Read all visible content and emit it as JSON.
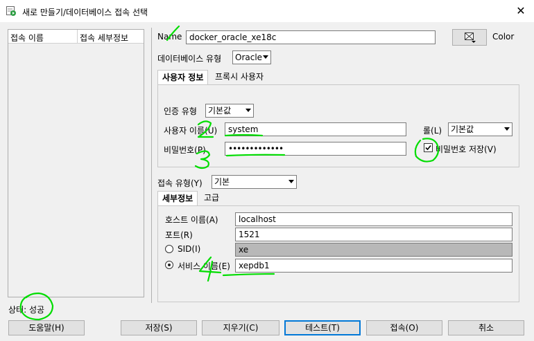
{
  "window": {
    "title": "새로 만들기/데이터베이스 접속 선택",
    "close_glyph": "✕"
  },
  "connection_list": {
    "col_name": "접속 이름",
    "col_detail": "접속 세부정보"
  },
  "form": {
    "name_label": "Name",
    "name_value": "docker_oracle_xe18c",
    "color_label": "Color",
    "db_type_label": "데이터베이스 유형",
    "db_type_value": "Oracle",
    "tabs": {
      "user_info": "사용자 정보",
      "proxy_user": "프록시 사용자"
    },
    "auth_type_label": "인증 유형",
    "auth_type_value": "기본값",
    "username_label": "사용자 이름(U)",
    "username_value": "system",
    "role_label": "롤(L)",
    "role_value": "기본값",
    "password_label": "비밀번호(P)",
    "password_value": "•••••••••••••",
    "save_password_label": "비밀번호 저장(V)",
    "save_password_checked": true,
    "conn_type_label": "접속 유형(Y)",
    "conn_type_value": "기본",
    "detail_tabs": {
      "details": "세부정보",
      "advanced": "고급"
    },
    "host_label": "호스트 이름(A)",
    "host_value": "localhost",
    "port_label": "포트(R)",
    "port_value": "1521",
    "sid_label": "SID(I)",
    "sid_value": "xe",
    "service_label": "서비스 이름(E)",
    "service_value": "xepdb1",
    "selected_option": "service"
  },
  "status": {
    "text": "상태: 성공"
  },
  "buttons": {
    "help": "도움말(H)",
    "save": "저장(S)",
    "clear": "지우기(C)",
    "test": "테스트(T)",
    "connect": "접속(O)",
    "cancel": "취소"
  },
  "annotations": {
    "n1": "1",
    "n2": "2",
    "n3": "3",
    "n4": "4",
    "color": "#00dd00"
  }
}
